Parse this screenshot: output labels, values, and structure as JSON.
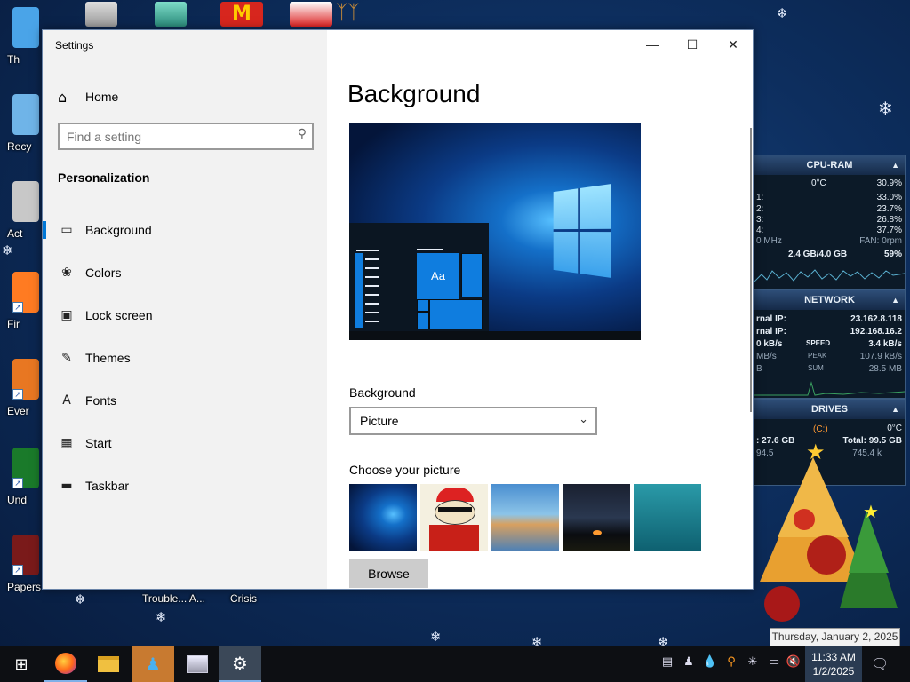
{
  "desktop": {
    "icons": [
      {
        "label": "Th",
        "name": "desktop-icon-this-pc",
        "color": "#4aa4e8"
      },
      {
        "label": "Recy",
        "name": "desktop-icon-recycle-bin",
        "color": "#6fb4e8"
      },
      {
        "label": "Act",
        "name": "desktop-icon-activate",
        "color": "#c8c8c8"
      },
      {
        "label": "Fir",
        "name": "desktop-icon-firefox",
        "color": "#ff7b22"
      },
      {
        "label": "Ever",
        "name": "desktop-icon-everything",
        "color": "#e87722"
      },
      {
        "label": "Und",
        "name": "desktop-icon-undertale",
        "color": "#1a7a2a"
      },
      {
        "label": "Papers, P",
        "name": "desktop-icon-papers-please",
        "color": "#7a1a1a"
      }
    ],
    "bottom_labels": [
      "Trouble... A...",
      "Crisis"
    ]
  },
  "settings": {
    "window_title": "Settings",
    "home": "Home",
    "search_placeholder": "Find a setting",
    "section": "Personalization",
    "nav": [
      {
        "label": "Background",
        "icon": "picture-icon",
        "glyph": "▭"
      },
      {
        "label": "Colors",
        "icon": "palette-icon",
        "glyph": "❀"
      },
      {
        "label": "Lock screen",
        "icon": "lock-screen-icon",
        "glyph": "▣"
      },
      {
        "label": "Themes",
        "icon": "brush-icon",
        "glyph": "✎"
      },
      {
        "label": "Fonts",
        "icon": "font-icon",
        "glyph": "A"
      },
      {
        "label": "Start",
        "icon": "start-grid-icon",
        "glyph": "▦"
      },
      {
        "label": "Taskbar",
        "icon": "taskbar-icon",
        "glyph": "▬"
      }
    ],
    "page_title": "Background",
    "preview_sample": "Aa",
    "background_label": "Background",
    "background_value": "Picture",
    "choose_label": "Choose your picture",
    "browse": "Browse",
    "accent": "#0078d7"
  },
  "gadgets": {
    "cpu": {
      "title": "CPU-RAM",
      "temp": "0°C",
      "total": "30.9%",
      "cores": [
        {
          "l": "1:",
          "v": "33.0%"
        },
        {
          "l": "2:",
          "v": "23.7%"
        },
        {
          "l": "3:",
          "v": "26.8%"
        },
        {
          "l": "4:",
          "v": "37.7%"
        }
      ],
      "mhz": "0 MHz",
      "fan": "FAN: 0rpm",
      "ram": "2.4 GB/4.0 GB",
      "ram_pct": "59%"
    },
    "network": {
      "title": "NETWORK",
      "ext_label": "rnal IP:",
      "ext_ip": "23.162.8.118",
      "int_label": "rnal IP:",
      "int_ip": "192.168.16.2",
      "speed_l": "0 kB/s",
      "speed_tag": "SPEED",
      "speed_r": "3.4 kB/s",
      "peak_l": "MB/s",
      "peak_tag": "PEAK",
      "peak_r": "107.9 kB/s",
      "sum_l": "B",
      "sum_tag": "SUM",
      "sum_r": "28.5 MB"
    },
    "drives": {
      "title": "DRIVES",
      "temp": "0°C",
      "drive": "(C:)",
      "used": ": 27.6 GB",
      "total": "Total: 99.5 GB",
      "free_l": "94.5",
      "free_r": "745.4 k"
    }
  },
  "taskbar": {
    "time": "11:33 AM",
    "date": "1/2/2025",
    "tooltip": "Thursday, January 2, 2025"
  }
}
